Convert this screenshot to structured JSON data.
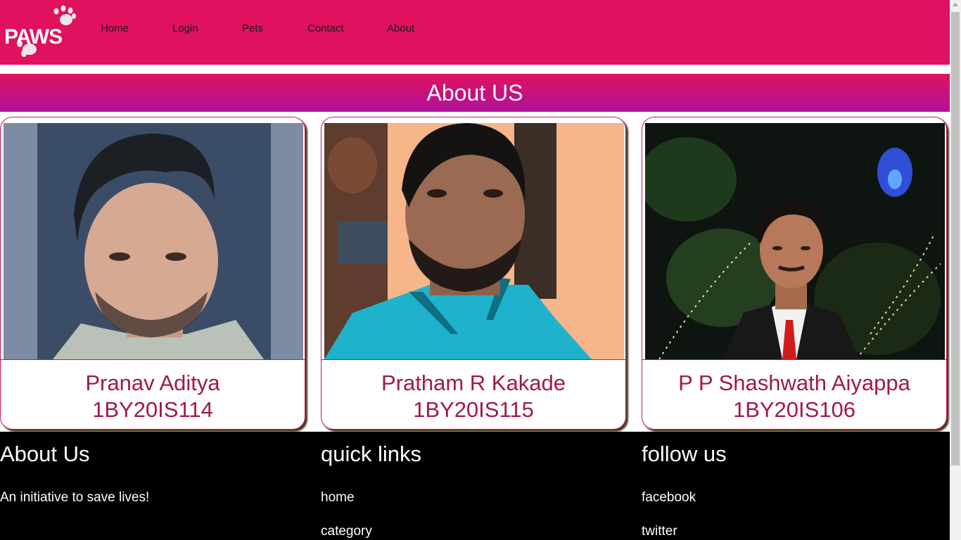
{
  "logo": {
    "text": "PAWS",
    "icon": "paw-logo-icon"
  },
  "nav": {
    "links": [
      {
        "label": "Home"
      },
      {
        "label": "Login"
      },
      {
        "label": "Pets"
      },
      {
        "label": "Contact"
      },
      {
        "label": "About"
      }
    ]
  },
  "banner": {
    "title": "About US"
  },
  "team": [
    {
      "name": "Pranav Aditya",
      "usn": "1BY20IS114"
    },
    {
      "name": "Pratham R Kakade",
      "usn": "1BY20IS115"
    },
    {
      "name": "P P Shashwath Aiyappa",
      "usn": "1BY20IS106"
    }
  ],
  "footer": {
    "about": {
      "title": "About Us",
      "text": "An initiative to save lives!"
    },
    "quick_links": {
      "title": "quick links",
      "links": [
        "home",
        "category"
      ]
    },
    "follow": {
      "title": "follow us",
      "links": [
        "facebook",
        "twitter"
      ]
    }
  },
  "colors": {
    "brand": "#e0115f",
    "banner_end": "#b0139a",
    "card_text": "#a3164f",
    "footer_bg": "#000000"
  }
}
